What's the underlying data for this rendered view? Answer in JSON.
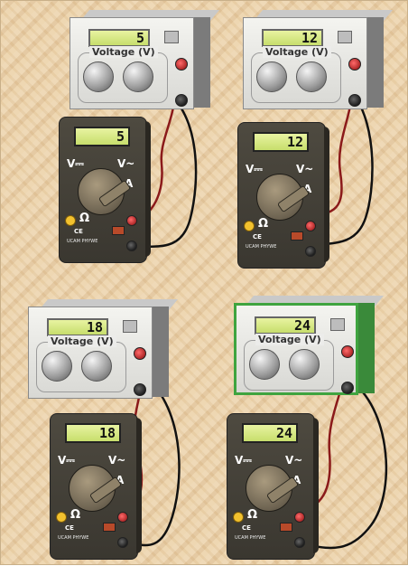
{
  "units": [
    {
      "supply_reading": "5",
      "meter_reading": "5",
      "voltage_label": "Voltage  (V)",
      "selected": false
    },
    {
      "supply_reading": "12",
      "meter_reading": "12",
      "voltage_label": "Voltage  (V)",
      "selected": false
    },
    {
      "supply_reading": "18",
      "meter_reading": "18",
      "voltage_label": "Voltage  (V)",
      "selected": false
    },
    {
      "supply_reading": "24",
      "meter_reading": "24",
      "voltage_label": "Voltage  (V)",
      "selected": true
    }
  ],
  "meter_labels": {
    "v_dc": "V⎓",
    "v_ac": "V~",
    "amp": "A",
    "ohm": "Ω",
    "ce": "CE",
    "brand": "UCAM PHYWE"
  },
  "colors": {
    "lead_positive": "#8b1a1a",
    "lead_negative": "#111111",
    "selection_outline": "#3fa43f",
    "display_lcd": "#d9ea8a",
    "background": "#ecd3ab"
  }
}
